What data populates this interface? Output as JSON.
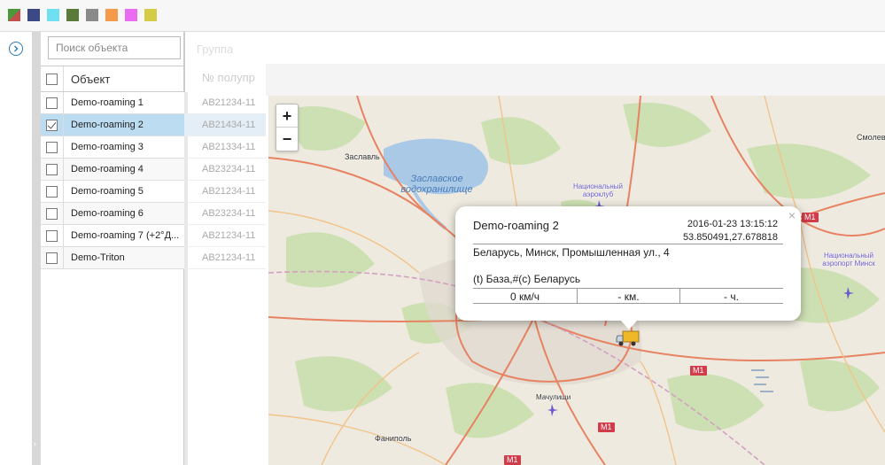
{
  "toolbar": {
    "swatches": [
      {
        "name": "red-green",
        "color": "#c0504d"
      },
      {
        "name": "navy",
        "color": "#3b4a87"
      },
      {
        "name": "cyan",
        "color": "#6fe0f0"
      },
      {
        "name": "olive",
        "color": "#5a7a3a"
      },
      {
        "name": "gray",
        "color": "#8a8a8a"
      },
      {
        "name": "orange",
        "color": "#f59a4b"
      },
      {
        "name": "magenta",
        "color": "#ea6cf0"
      },
      {
        "name": "yellow",
        "color": "#d4cc45"
      }
    ]
  },
  "sidebar": {
    "expand_icon": "chevron-right-circle-icon"
  },
  "objects": {
    "search_placeholder": "Поиск объекта",
    "header": "Объект",
    "items": [
      {
        "label": "Demo-roaming 1",
        "checked": false,
        "selected": false
      },
      {
        "label": "Demo-roaming 2",
        "checked": true,
        "selected": true
      },
      {
        "label": "Demo-roaming 3",
        "checked": false,
        "selected": false
      },
      {
        "label": "Demo-roaming 4",
        "checked": false,
        "selected": false
      },
      {
        "label": "Demo-roaming 5",
        "checked": false,
        "selected": false
      },
      {
        "label": "Demo-roaming 6",
        "checked": false,
        "selected": false
      },
      {
        "label": "Demo-roaming 7 (+2°Д...",
        "checked": false,
        "selected": false
      },
      {
        "label": "Demo-Triton",
        "checked": false,
        "selected": false
      }
    ]
  },
  "groups": {
    "header": "Группа",
    "col_header": "№ полупр",
    "plates": [
      "AB21234-11",
      "AB21434-11",
      "AB21334-11",
      "AB23234-11",
      "AB21234-11",
      "AB23234-11",
      "AB21234-11",
      "AB21234-11"
    ]
  },
  "map": {
    "zoom_in": "+",
    "zoom_out": "−",
    "labels": {
      "zaslavl": "Заславль",
      "reservoir": "Заславское водохранилище",
      "nat_airport1": "Национальный аэроклуб",
      "nat_airport2": "Национальный аэропорт Минск",
      "smolevichi": "Смолев",
      "machulishchi": "Мачулищи",
      "fanipol": "Фаниполь"
    },
    "shields": [
      "M1",
      "M1",
      "M1",
      "M1"
    ]
  },
  "popup": {
    "title": "Demo-roaming 2",
    "datetime": "2016-01-23 13:15:12",
    "coords": "53.850491,27.678818",
    "address": "Беларусь, Минск, Промышленная ул., 4",
    "zone": "(t) База,#(c) Беларусь",
    "speed": "0 км/ч",
    "distance": "- км.",
    "hours": "- ч.",
    "close": "×"
  }
}
